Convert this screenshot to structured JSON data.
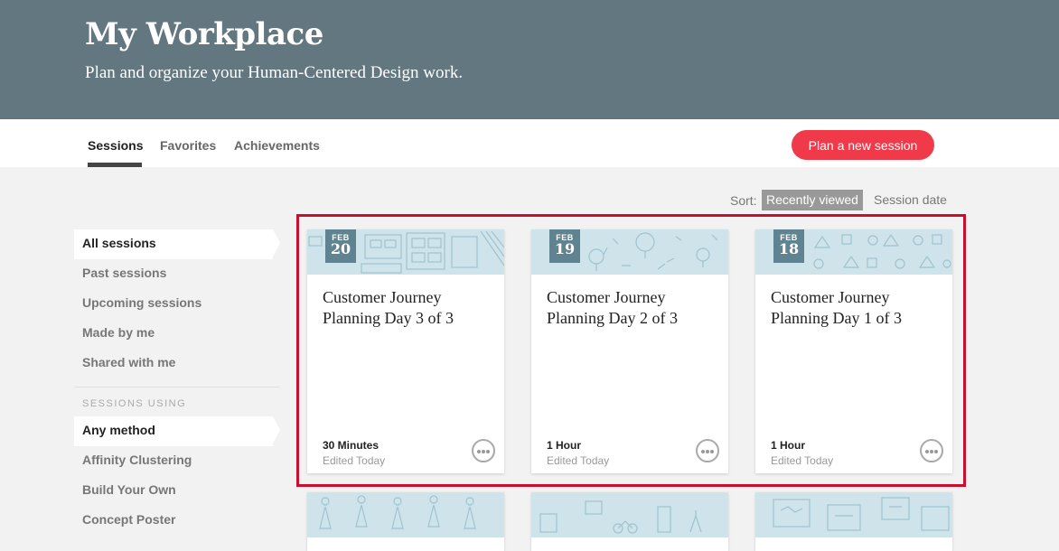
{
  "hero": {
    "title": "My Workplace",
    "subtitle": "Plan and organize your Human-Centered Design work."
  },
  "tabs": [
    {
      "label": "Sessions",
      "active": true
    },
    {
      "label": "Favorites",
      "active": false
    },
    {
      "label": "Achievements",
      "active": false
    }
  ],
  "plan_button": "Plan a new session",
  "sort": {
    "label": "Sort:",
    "options": [
      "Recently viewed",
      "Session date"
    ],
    "selected": "Recently viewed"
  },
  "sidebar": {
    "items": [
      "All sessions",
      "Past sessions",
      "Upcoming sessions",
      "Made by me",
      "Shared with me"
    ],
    "active": "All sessions",
    "methods_heading": "SESSIONS USING",
    "methods": [
      "Any method",
      "Affinity Clustering",
      "Build Your Own",
      "Concept Poster"
    ],
    "active_method": "Any method"
  },
  "cards": [
    {
      "month": "FEB",
      "day": "20",
      "title": "Customer Journey Planning Day 3 of 3",
      "duration": "30 Minutes",
      "edited": "Edited Today",
      "pattern": "boards"
    },
    {
      "month": "FEB",
      "day": "19",
      "title": "Customer Journey Planning Day 2 of 3",
      "duration": "1 Hour",
      "edited": "Edited Today",
      "pattern": "bulbs"
    },
    {
      "month": "FEB",
      "day": "18",
      "title": "Customer Journey Planning Day 1 of 3",
      "duration": "1 Hour",
      "edited": "Edited Today",
      "pattern": "shapes"
    }
  ],
  "colors": {
    "hero_bg": "#637780",
    "accent_button": "#f03a4a",
    "highlight_border": "#c8102e",
    "date_badge": "#5f8390",
    "card_banner": "#cfe3ea"
  }
}
